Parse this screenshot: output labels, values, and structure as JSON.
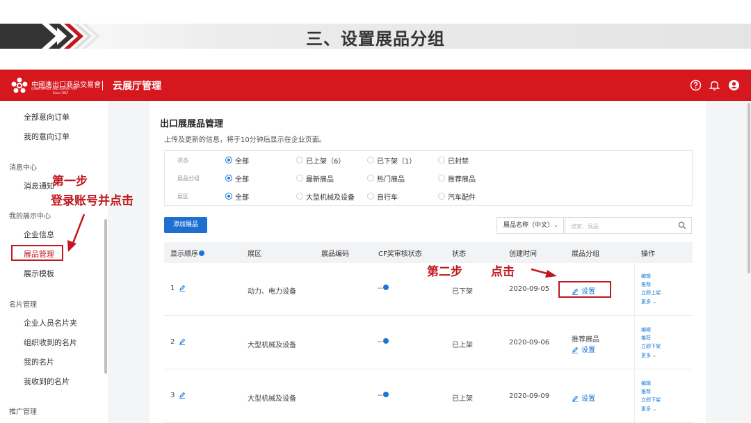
{
  "slide": {
    "title": "三、设置展品分组"
  },
  "header": {
    "logo_text": "中國進出口商品交易會",
    "logo_subtext": "CHINA IMPORT AND EXPORT FAIR",
    "logo_year": "Since 1957",
    "app_title": "云展厅管理",
    "icons": [
      "help-circle-icon",
      "bell-icon",
      "user-icon"
    ],
    "brand_color": "#d7171e"
  },
  "sidebar": {
    "items": [
      {
        "label": "全部意向订单",
        "type": "item"
      },
      {
        "label": "我的意向订单",
        "type": "item"
      },
      {
        "label": "消息中心",
        "type": "section"
      },
      {
        "label": "消息通知",
        "type": "item"
      },
      {
        "label": "我的展示中心",
        "type": "section"
      },
      {
        "label": "企业信息",
        "type": "item"
      },
      {
        "label": "展品管理",
        "type": "item",
        "active": true
      },
      {
        "label": "展示模板",
        "type": "item"
      },
      {
        "label": "名片管理",
        "type": "section"
      },
      {
        "label": "企业人员名片夹",
        "type": "item"
      },
      {
        "label": "组织收到的名片",
        "type": "item"
      },
      {
        "label": "我的名片",
        "type": "item"
      },
      {
        "label": "我收到的名片",
        "type": "item"
      },
      {
        "label": "推广管理",
        "type": "section"
      }
    ]
  },
  "page": {
    "title": "出口展展品管理",
    "description": "上传及更新的信息，将于10分钟后显示在企业页面。"
  },
  "filters": {
    "status": {
      "label": "状态",
      "options": [
        "全部",
        "已上架（6）",
        "已下架（1）",
        "已封禁"
      ],
      "selected": "全部"
    },
    "group": {
      "label": "展品分组",
      "options": [
        "全部",
        "最新展品",
        "热门展品",
        "推荐展品"
      ],
      "selected": "全部"
    },
    "area": {
      "label": "展区",
      "options": [
        "全部",
        "大型机械及设备",
        "自行车",
        "汽车配件"
      ],
      "selected": "全部"
    }
  },
  "toolbar": {
    "add_label": "添加展品",
    "search_field_select": "展品名称（中文）",
    "search_placeholder": "搜索：展品"
  },
  "table": {
    "columns": [
      "显示顺序",
      "展区",
      "展品编码",
      "CF奖审核状态",
      "状态",
      "创建时间",
      "展品分组",
      "操作"
    ],
    "rows": [
      {
        "order": "1",
        "area": "动力、电力设备",
        "code": "",
        "cf_status": "--",
        "status": "已下架",
        "created": "2020-09-05",
        "group": "",
        "set_label": "设置",
        "ops": [
          "编辑",
          "推荐",
          "立即上架",
          "更多"
        ]
      },
      {
        "order": "2",
        "area": "大型机械及设备",
        "code": "",
        "cf_status": "--",
        "status": "已上架",
        "created": "2020-09-06",
        "group": "推荐展品",
        "set_label": "设置",
        "ops": [
          "编辑",
          "推荐",
          "立即下架",
          "更多"
        ]
      },
      {
        "order": "3",
        "area": "大型机械及设备",
        "code": "",
        "cf_status": "--",
        "status": "已上架",
        "created": "2020-09-09",
        "group": "",
        "set_label": "设置",
        "ops": [
          "编辑",
          "推荐",
          "立即下架",
          "更多"
        ]
      }
    ]
  },
  "annotations": {
    "step1_line1": "第一步",
    "step1_line2": "登录账号并点击",
    "step2": "第二步",
    "step2_click": "点击",
    "color": "#c0181e"
  }
}
